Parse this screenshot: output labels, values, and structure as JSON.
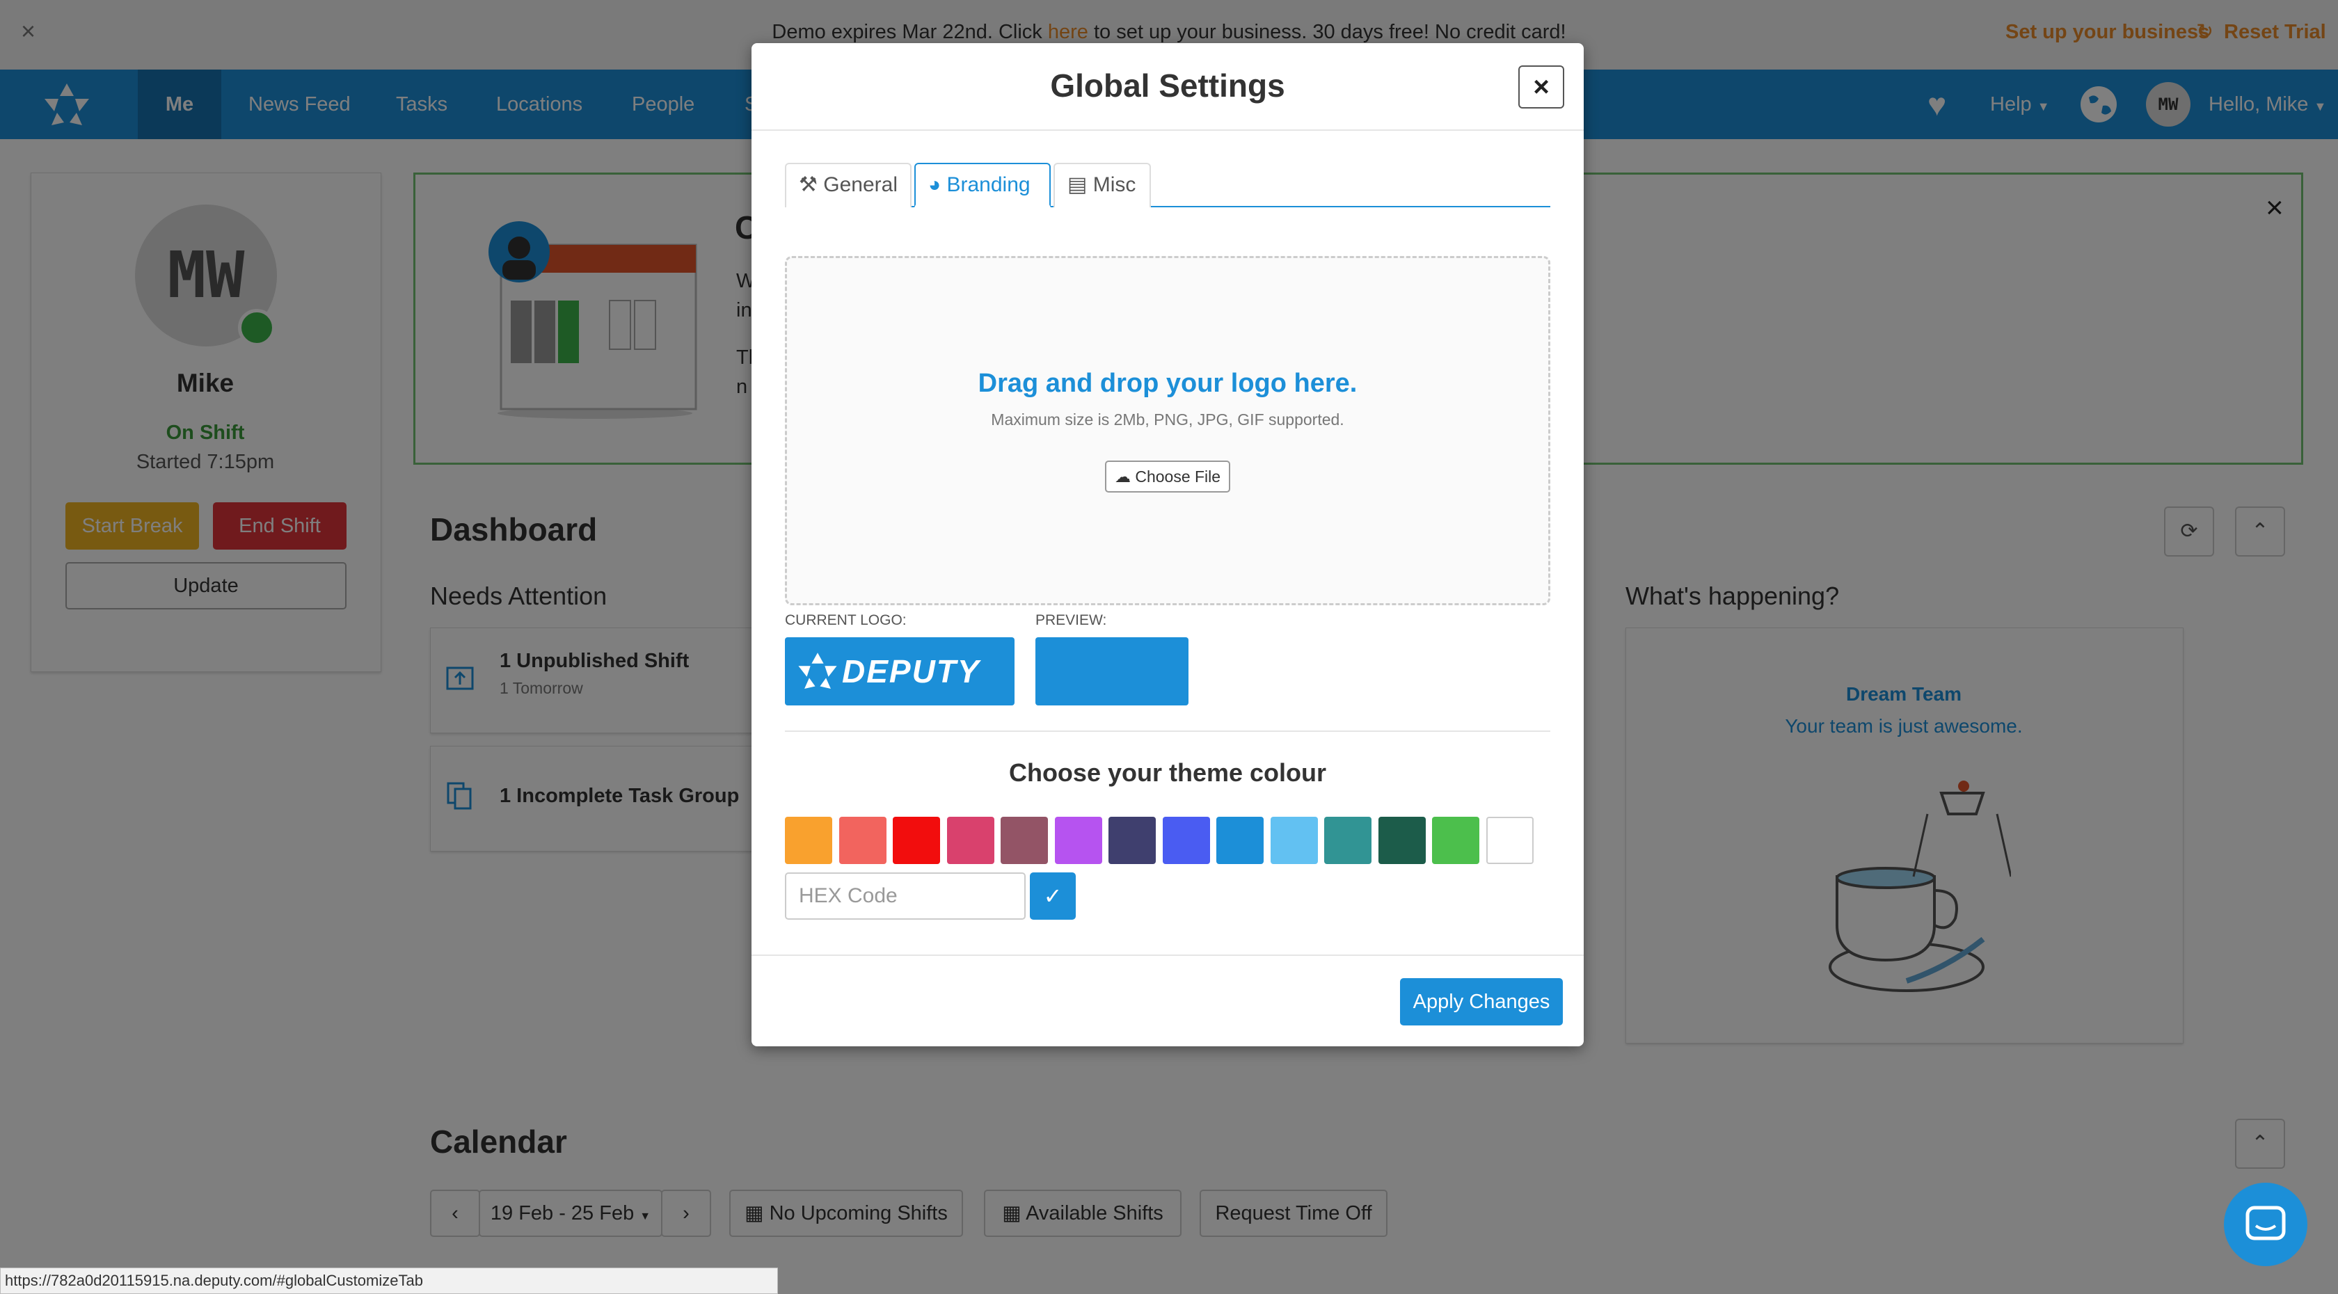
{
  "banner": {
    "close": "×",
    "text_before": "Demo expires Mar 22nd. Click ",
    "link": "here",
    "text_after": " to set up your business. 30 days free! No credit card!",
    "setup_label": "Set up your business",
    "reset_label": "Reset Trial"
  },
  "nav": {
    "items": [
      "Me",
      "News Feed",
      "Tasks",
      "Locations",
      "People",
      "S"
    ],
    "help": "Help",
    "avatar_initials": "MW",
    "greeting": "Hello, Mike"
  },
  "profile": {
    "initials": "MW",
    "name": "Mike",
    "status": "On Shift",
    "started": "Started 7:15pm",
    "start_break": "Start Break",
    "end_shift": "End Shift",
    "update": "Update"
  },
  "welcome": {
    "heading_initial": "C",
    "line1_initial": "W",
    "line2_initial": "in",
    "line3_initial": "Th",
    "line4_initial": "n",
    "close": "×"
  },
  "dashboard": {
    "title": "Dashboard",
    "needs_attention": "Needs Attention",
    "attention_items": [
      {
        "title": "1 Unpublished Shift",
        "sub": "1 Tomorrow"
      },
      {
        "title": "1 Incomplete Task Group",
        "sub": ""
      }
    ],
    "whats_happening": "What's happening?",
    "team_name": "Dream Team",
    "team_msg": "Your team is just awesome."
  },
  "calendar": {
    "title": "Calendar",
    "range": "19 Feb - 25 Feb",
    "no_upcoming": "No Upcoming Shifts",
    "available": "Available Shifts",
    "request_off": "Request Time Off"
  },
  "modal": {
    "title": "Global Settings",
    "close": "×",
    "tabs": [
      {
        "label": "General",
        "active": false
      },
      {
        "label": "Branding",
        "active": true
      },
      {
        "label": "Misc",
        "active": false
      }
    ],
    "dropzone_title": "Drag and drop your logo here.",
    "dropzone_sub": "Maximum size is 2Mb, PNG, JPG, GIF supported.",
    "choose_file": "Choose File",
    "current_logo_label": "CURRENT LOGO:",
    "preview_label": "PREVIEW:",
    "logo_text": "DEPUTY",
    "theme_title": "Choose your theme colour",
    "swatches": [
      "#f9a12e",
      "#f2645e",
      "#f20d0d",
      "#d9416d",
      "#935466",
      "#b653f0",
      "#3f3f6e",
      "#4a5cf2",
      "#1c8fd8",
      "#62c1f2",
      "#319494",
      "#1c5c4a",
      "#4cbf4c",
      "#ffffff"
    ],
    "hex_placeholder": "HEX Code",
    "hex_confirm": "✓",
    "apply": "Apply Changes"
  },
  "status_bar": {
    "url": "https://782a0d20115915.na.deputy.com/#globalCustomizeTab"
  },
  "colors": {
    "brand": "#1c8fd8",
    "orange": "#e98b2a",
    "green": "#3cb54a"
  }
}
